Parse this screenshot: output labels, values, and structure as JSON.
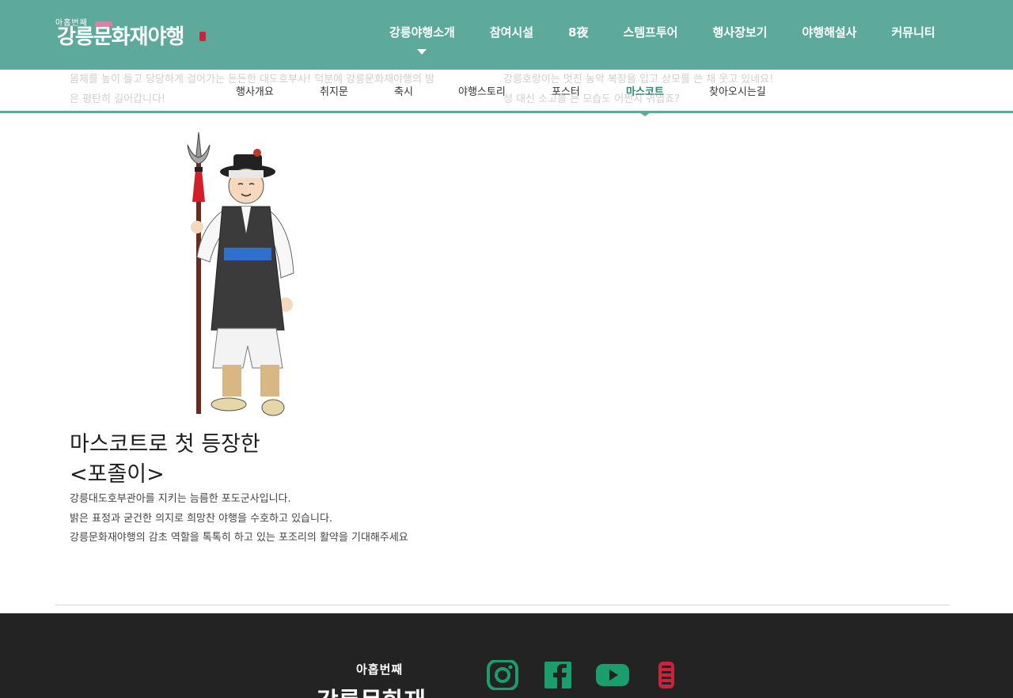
{
  "header": {
    "logo_small": "아홉번째",
    "logo_main": "강릉문화재야행",
    "nav": [
      {
        "label": "강릉야행소개"
      },
      {
        "label": "참여시설"
      },
      {
        "label": "8夜"
      },
      {
        "label": "스템프투어"
      },
      {
        "label": "행사장보기"
      },
      {
        "label": "야행해설사"
      },
      {
        "label": "커뮤니티"
      }
    ]
  },
  "ghost_text": {
    "left_1": "몸체를 높이 들고 당당하게 걸어가는 든든한 대도호부사! 덕분에 강릉문화재야행의 밤",
    "left_2": "은 평탄히 길어갑니다!",
    "right_1": "강릉호랑이는 멋진 농악 복장을 입고 상모를 쓴 채 웃고 있네요!",
    "right_2": "성 대신 소고를 든 모습도 어쩐지 귀엽죠?"
  },
  "subnav": [
    {
      "label": "행사개요"
    },
    {
      "label": "취지문"
    },
    {
      "label": "축시"
    },
    {
      "label": "야행스토리"
    },
    {
      "label": "포스터"
    },
    {
      "label": "마스코트",
      "active": true
    },
    {
      "label": "찾아오시는길"
    }
  ],
  "mascot": {
    "title_line1": "마스코트로 첫 등장한",
    "title_line2": "<포졸이>",
    "desc": [
      "강릉대도호부관아를 지키는 늠름한 포도군사입니다.",
      "밝은 표정과 굳건한 의지로 희망찬 야행을 수호하고 있습니다.",
      "강릉문화재야행의 감초 역할을 톡톡히 하고 있는 포조리의 활약을 기대해주세요"
    ]
  },
  "footer": {
    "logo_small": "아홉번째",
    "logo_main": "강릉문화재",
    "sns": [
      {
        "icon": "instagram-icon"
      },
      {
        "icon": "facebook-icon"
      },
      {
        "icon": "youtube-icon"
      },
      {
        "icon": "gangneung-stamp-icon"
      }
    ],
    "sns_color": "#1a9e6e"
  },
  "colors": {
    "brand": "#5daa9c",
    "active": "#2f8a76",
    "footer_bg": "#232323"
  }
}
